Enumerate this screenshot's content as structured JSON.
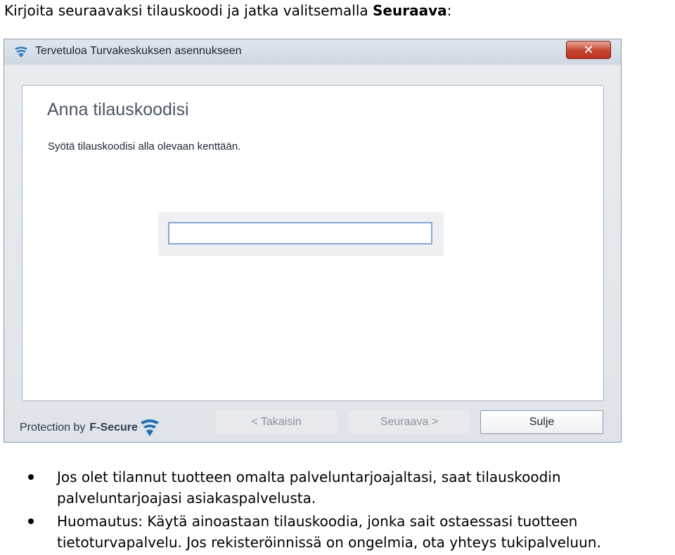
{
  "intro": {
    "text": "Kirjoita seuraavaksi tilauskoodi ja jatka valitsemalla ",
    "bold": "Seuraava",
    "suffix": ":"
  },
  "window": {
    "title": "Tervetuloa Turvakeskuksen asennukseen",
    "close_label": "✕",
    "heading": "Anna tilauskoodisi",
    "instruction": "Syötä tilauskoodisi alla olevaan kenttään.",
    "code_input": {
      "value": "",
      "placeholder": ""
    },
    "brand_prefix": "Protection by",
    "brand_name": "F-Secure",
    "buttons": {
      "back": "< Takaisin",
      "next": "Seuraava >",
      "close": "Sulje"
    }
  },
  "notes": [
    {
      "line1": "Jos olet tilannut tuotteen omalta palveluntarjoajaltasi, saat tilauskoodin",
      "line2": "palveluntarjoajasi asiakaspalvelusta."
    },
    {
      "line1": "Huomautus: Käytä ainoastaan tilauskoodia, jonka sait ostaessasi tuotteen",
      "line2": "tietoturvapalvelu. Jos rekisteröinnissä on ongelmia, ota yhteys tukipalveluun."
    }
  ],
  "colors": {
    "accent": "#86a7d3",
    "close_button": "#c6432e",
    "heading": "#4a5566"
  },
  "icons": {
    "app": "f-secure-shield-icon",
    "close": "close-icon",
    "brand": "f-secure-logo-icon",
    "bullet": "bullet-icon"
  }
}
